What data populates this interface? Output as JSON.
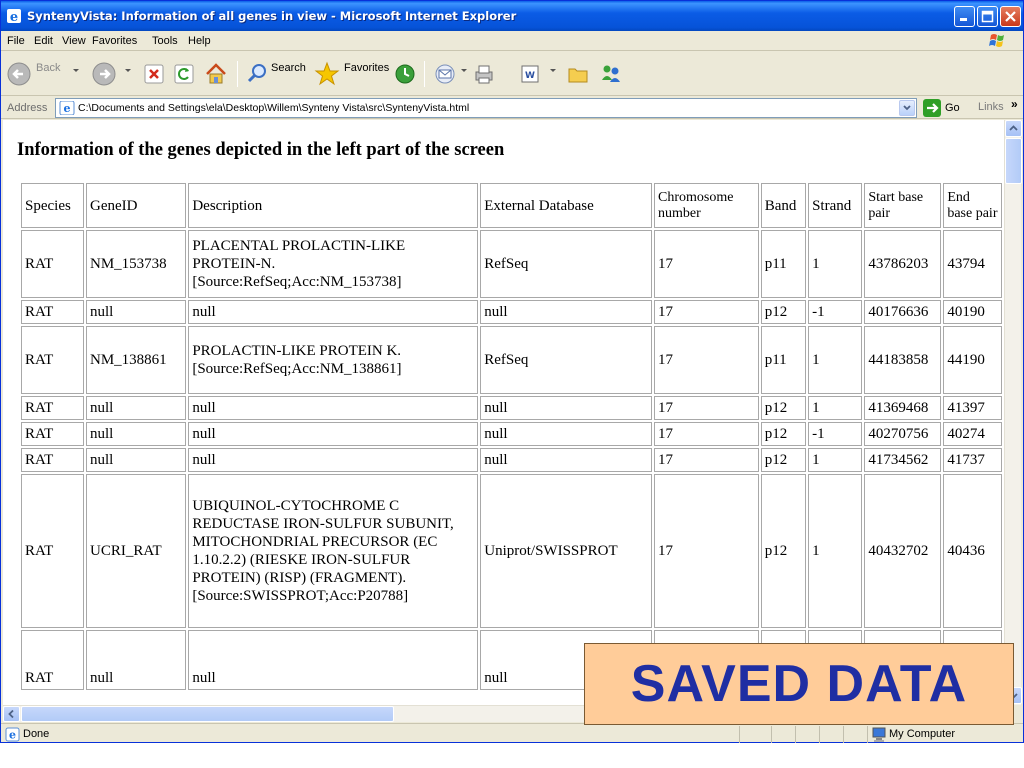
{
  "window": {
    "title": "SyntenyVista: Information of all genes in view - Microsoft Internet Explorer"
  },
  "menu": [
    "File",
    "Edit",
    "View",
    "Favorites",
    "Tools",
    "Help"
  ],
  "toolbar": {
    "back_label": "Back",
    "search_label": "Search",
    "favorites_label": "Favorites"
  },
  "address": {
    "label": "Address",
    "url": "C:\\Documents and Settings\\ela\\Desktop\\Willem\\Synteny Vista\\src\\SyntenyVista.html",
    "go_label": "Go",
    "links_label": "Links"
  },
  "page": {
    "heading": "Information of the genes depicted in the left part of the screen"
  },
  "table": {
    "headers": [
      "Species",
      "GeneID",
      "Description",
      "External Database",
      "Chromosome number",
      "Band",
      "Strand",
      "Start base pair",
      "End base pair"
    ],
    "rows": [
      [
        "RAT",
        "NM_153738",
        "PLACENTAL PROLACTIN-LIKE PROTEIN-N. [Source:RefSeq;Acc:NM_153738]",
        "RefSeq",
        "17",
        "p11",
        "1",
        "43786203",
        "43794"
      ],
      [
        "RAT",
        "null",
        "null",
        "null",
        "17",
        "p12",
        "-1",
        "40176636",
        "40190"
      ],
      [
        "RAT",
        "NM_138861",
        "PROLACTIN-LIKE PROTEIN K. [Source:RefSeq;Acc:NM_138861]",
        "RefSeq",
        "17",
        "p11",
        "1",
        "44183858",
        "44190"
      ],
      [
        "RAT",
        "null",
        "null",
        "null",
        "17",
        "p12",
        "1",
        "41369468",
        "41397"
      ],
      [
        "RAT",
        "null",
        "null",
        "null",
        "17",
        "p12",
        "-1",
        "40270756",
        "40274"
      ],
      [
        "RAT",
        "null",
        "null",
        "null",
        "17",
        "p12",
        "1",
        "41734562",
        "41737"
      ],
      [
        "RAT",
        "UCRI_RAT",
        "UBIQUINOL-CYTOCHROME C REDUCTASE IRON-SULFUR SUBUNIT, MITOCHONDRIAL PRECURSOR (EC 1.10.2.2) (RIESKE IRON-SULFUR PROTEIN) (RISP) (FRAGMENT). [Source:SWISSPROT;Acc:P20788]",
        "Uniprot/SWISSPROT",
        "17",
        "p12",
        "1",
        "40432702",
        "40436"
      ],
      [
        "RAT",
        "null",
        "null",
        "null",
        "",
        "",
        "",
        "",
        ""
      ]
    ]
  },
  "status": {
    "text": "Done",
    "zone": "My Computer"
  },
  "overlay": {
    "text": "SAVED DATA"
  },
  "colors": {
    "titlebar": "#0653d8",
    "overlay_bg": "#ffcc99",
    "overlay_text": "#1f2ea3"
  }
}
